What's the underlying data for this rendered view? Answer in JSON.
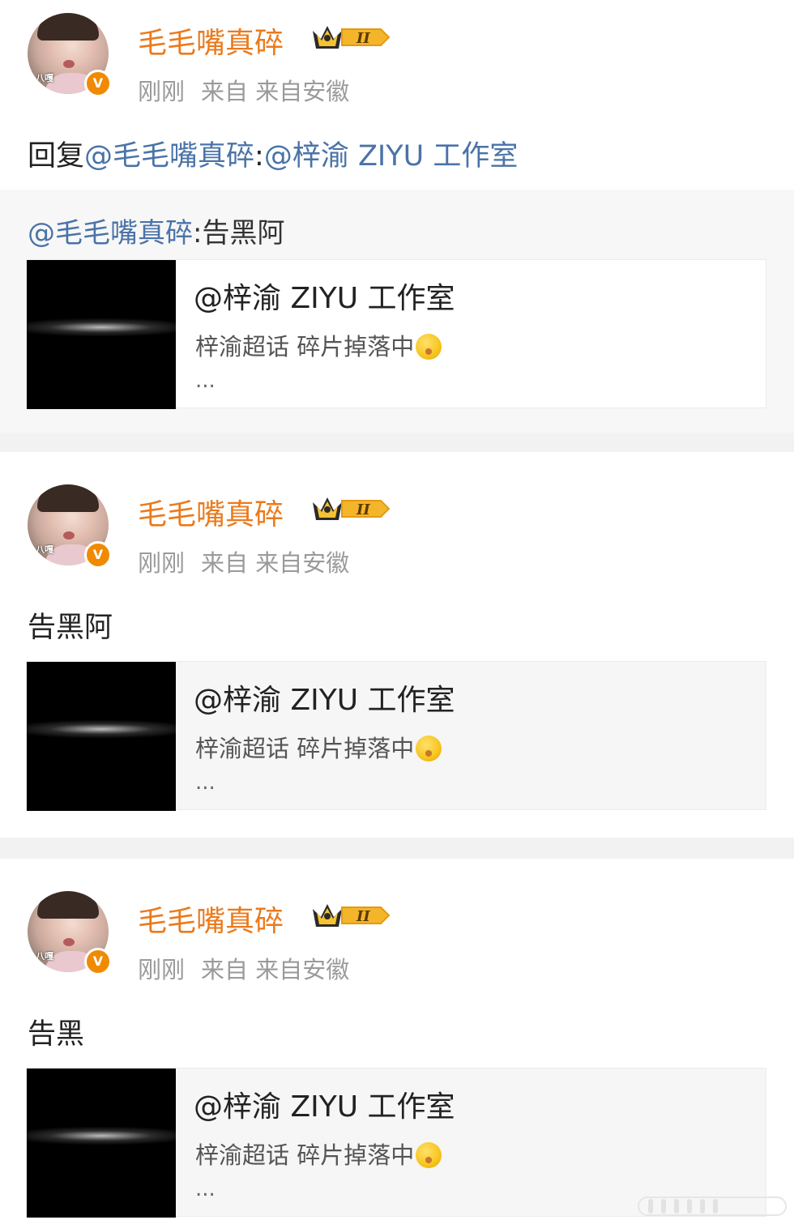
{
  "posts": [
    {
      "username": "毛毛嘴真碎",
      "time": "刚刚",
      "source": "来自 来自安徽",
      "avatar_caption": "八嘎",
      "reply_prefix": "回复",
      "reply_to": "@毛毛嘴真碎",
      "reply_colon": ":",
      "reply_mention": "@梓渝 ZIYU 工作室",
      "quote": {
        "author": "@毛毛嘴真碎",
        "text": ":告黑阿"
      },
      "card": {
        "title": "@梓渝 ZIYU 工作室",
        "description": "梓渝超话 碎片掉落中",
        "more": "..."
      }
    },
    {
      "username": "毛毛嘴真碎",
      "time": "刚刚",
      "source": "来自 来自安徽",
      "avatar_caption": "八嘎",
      "text": "告黑阿",
      "card": {
        "title": "@梓渝 ZIYU 工作室",
        "description": "梓渝超话 碎片掉落中",
        "more": "..."
      }
    },
    {
      "username": "毛毛嘴真碎",
      "time": "刚刚",
      "source": "来自 来自安徽",
      "avatar_caption": "八嘎",
      "text": "告黑",
      "card": {
        "title": "@梓渝 ZIYU 工作室",
        "description": "梓渝超话 碎片掉落中",
        "more": "..."
      }
    }
  ],
  "badge": {
    "level": "II",
    "icon": "crown-icon",
    "color": "#f5a623"
  },
  "verified_icon": "v-badge-icon",
  "colors": {
    "username": "#eb7a1c",
    "mention": "#4a73a8",
    "meta": "#9a9a9a"
  }
}
